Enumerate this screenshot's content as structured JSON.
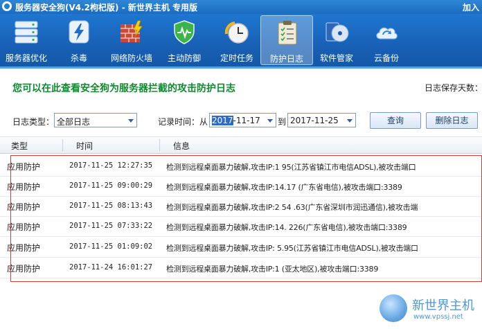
{
  "window": {
    "title": "服务器安全狗(V4.2枸杞版) - 新世界主机 专用版",
    "join": "加入"
  },
  "toolbar": {
    "items": [
      {
        "label": "服务器优化",
        "icon": "server-icon"
      },
      {
        "label": "杀毒",
        "icon": "lightning-icon"
      },
      {
        "label": "网络防火墙",
        "icon": "firewall-icon"
      },
      {
        "label": "主动防御",
        "icon": "shield-icon"
      },
      {
        "label": "定时任务",
        "icon": "clock-icon"
      },
      {
        "label": "防护日志",
        "icon": "clipboard-icon"
      },
      {
        "label": "软件管家",
        "icon": "disc-icon"
      },
      {
        "label": "云备份",
        "icon": "cloud-icon"
      }
    ],
    "active": "防护日志"
  },
  "header": {
    "headline": "您可以在此查看安全狗为服务器拦截的攻击防护日志",
    "keep_days_label": "日志保存天数："
  },
  "filter": {
    "type_label": "日志类型：",
    "type_value": "全部日志",
    "time_label": "记录时间：从",
    "from_highlight": "2017",
    "from_rest": "-11-17",
    "to_label": "到",
    "to_value": "2017-11-25",
    "query_button": "查询",
    "delete_button": "删除日志"
  },
  "table": {
    "columns": [
      "类型",
      "时间",
      "信息"
    ],
    "rows": [
      {
        "type": "应用防护",
        "time": "2017-11-25 12:27:35",
        "info": "检测到远程桌面暴力破解,攻击IP:1          95(江苏省镇江市电信ADSL),被攻击端口"
      },
      {
        "type": "应用防护",
        "time": "2017-11-25 09:00:29",
        "info": "检测到远程桌面暴力破解,攻击IP:14.17           (广东省电信),被攻击端口:3389"
      },
      {
        "type": "应用防护",
        "time": "2017-11-25 08:13:43",
        "info": "检测到远程桌面暴力破解,攻击IP:2      54   .63(广东省深圳市润迅通信),被攻击端"
      },
      {
        "type": "应用防护",
        "time": "2017-11-25 07:33:22",
        "info": "检测到远程桌面暴力破解,攻击IP:14.        226(广东省电信),被攻击端口:3389"
      },
      {
        "type": "应用防护",
        "time": "2017-11-25 01:09:02",
        "info": "检测到远程桌面暴力破解,攻击IP:         5.95(江苏省镇江市电信ADSL),被攻击端口"
      },
      {
        "type": "应用防护",
        "time": "2017-11-24 16:01:27",
        "info": "检测到远程桌面暴力破解,攻击IP:1           (亚太地区),被攻击端口:3389"
      }
    ]
  },
  "watermark": {
    "text": "新世界主机",
    "url": "www.vpssj.net"
  }
}
